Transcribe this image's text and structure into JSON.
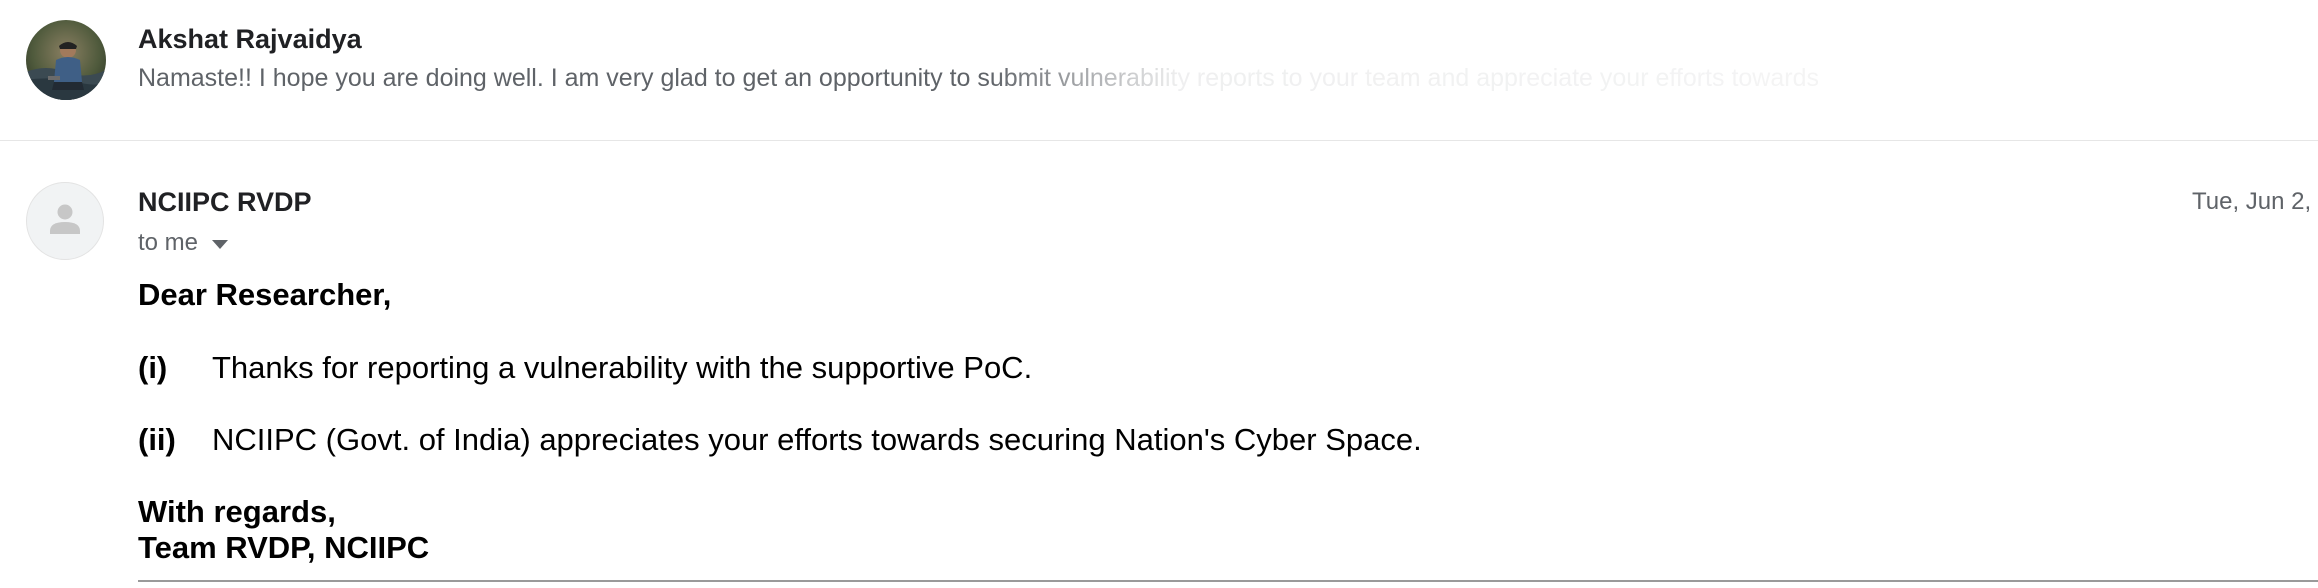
{
  "thread": {
    "collapsed_message": {
      "sender": "Akshat Rajvaidya",
      "snippet": "Namaste!! I hope you are doing well. I am very glad to get an opportunity to submit vulnerability reports to your team and appreciate your efforts towards"
    },
    "open_message": {
      "sender": "NCIIPC RVDP",
      "recipient": "to me",
      "date": "Tue, Jun 2,",
      "greeting": "Dear Researcher,",
      "items": [
        {
          "num": "(i)",
          "text": "Thanks for reporting a vulnerability with the supportive PoC."
        },
        {
          "num": "(ii)",
          "text": "NCIIPC (Govt. of India) appreciates your efforts towards securing Nation's Cyber Space."
        }
      ],
      "signoff": "With regards,",
      "signature": "Team RVDP, NCIIPC"
    }
  },
  "icons": {
    "sender_avatar": "profile-photo",
    "default_avatar": "person-icon",
    "recipient_details": "caret-down-icon"
  },
  "colors": {
    "sender_text": "#202124",
    "secondary_text": "#5f6368",
    "divider": "#e6e6e6"
  }
}
